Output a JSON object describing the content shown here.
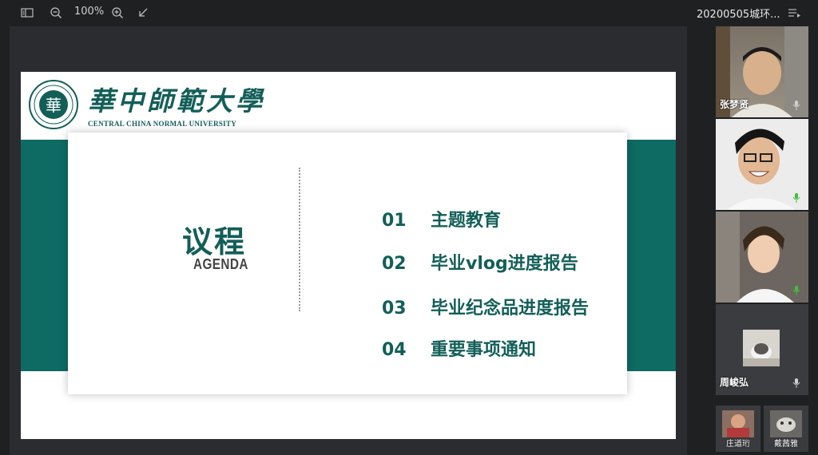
{
  "toolbar": {
    "zoom_level": "100%",
    "meeting_title": "20200505城环..."
  },
  "slide": {
    "university_cn": "華中師範大學",
    "university_en": "CENTRAL CHINA NORMAL UNIVERSITY",
    "seal_text": "華",
    "agenda_cn": "议程",
    "agenda_en": "AGENDA",
    "items": [
      {
        "num": "01",
        "label": "主题教育"
      },
      {
        "num": "02",
        "label": "毕业vlog进度报告"
      },
      {
        "num": "03",
        "label": "毕业纪念品进度报告"
      },
      {
        "num": "04",
        "label": "重要事项通知"
      }
    ]
  },
  "participants": [
    {
      "name": "张梦贤",
      "mic": "muted"
    },
    {
      "name": "",
      "mic": "active"
    },
    {
      "name": "",
      "mic": "active"
    },
    {
      "name": "周峻弘",
      "mic": "muted"
    }
  ],
  "thumbnails": [
    {
      "name": "庄道珩"
    },
    {
      "name": "戴茜雅"
    }
  ],
  "colors": {
    "teal": "#0e6b64",
    "mic_active": "#3cc13c"
  }
}
